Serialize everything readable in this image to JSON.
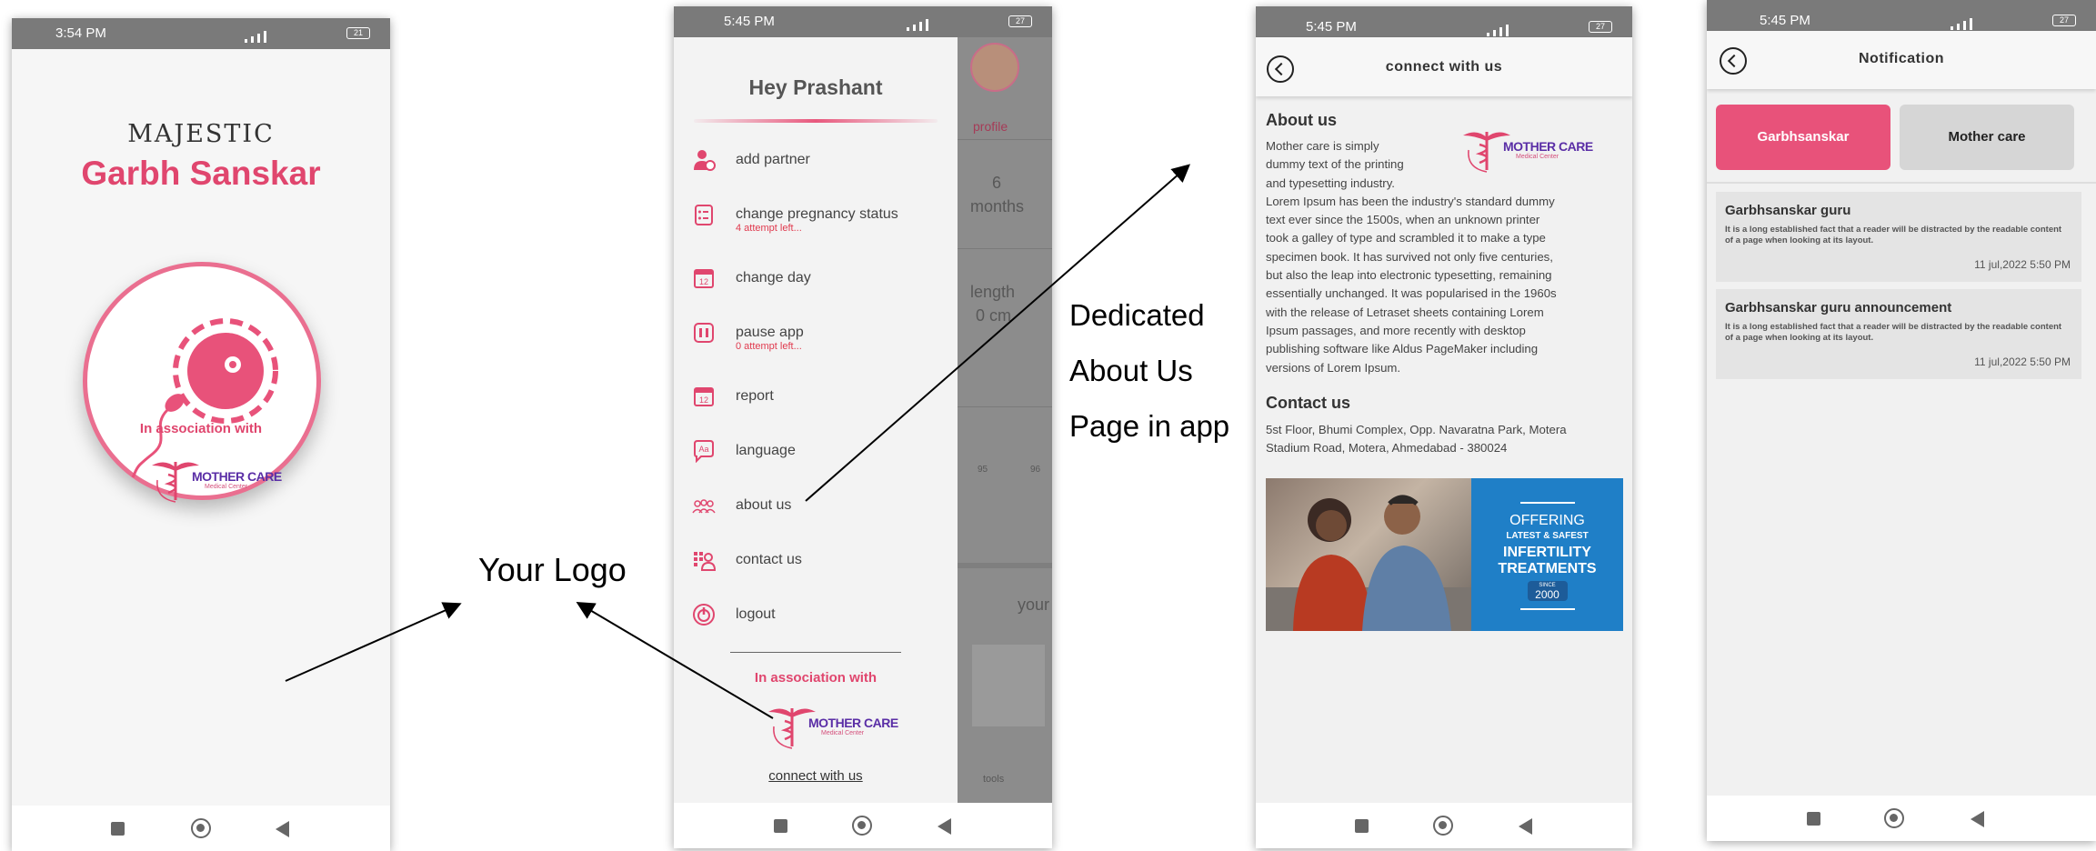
{
  "screen1": {
    "status_time": "3:54 PM",
    "battery": "21",
    "brand_line1": "MAJESTIC",
    "brand_line2": "Garbh Sanskar",
    "association_text": "In association with",
    "partner_logo_title": "MOTHER CARE",
    "partner_logo_subtitle": "Medical Center"
  },
  "screen2": {
    "status_time": "5:45 PM",
    "battery": "27",
    "greeting": "Hey Prashant",
    "menu": [
      {
        "label": "add partner",
        "icon": "person-add-icon"
      },
      {
        "label": "change pregnancy status",
        "sub": "4 attempt left...",
        "icon": "checklist-icon"
      },
      {
        "label": "change day",
        "icon": "calendar-icon"
      },
      {
        "label": "pause app",
        "sub": "0 attempt left...",
        "icon": "pause-icon"
      },
      {
        "label": "report",
        "icon": "calendar-report-icon"
      },
      {
        "label": "language",
        "icon": "language-icon"
      },
      {
        "label": "about us",
        "icon": "group-icon"
      },
      {
        "label": "contact us",
        "icon": "contact-icon"
      },
      {
        "label": "logout",
        "icon": "power-icon"
      }
    ],
    "association_text": "In association with",
    "partner_logo_title": "MOTHER CARE",
    "partner_logo_subtitle": "Medical Center",
    "connect_link": "connect with us",
    "background": {
      "profile_label": "profile",
      "months_value": "6",
      "months_label": "months",
      "length_label": "length",
      "length_value": "0 cm",
      "lock_a": "95",
      "lock_b": "96",
      "your_text": "your",
      "tools_label": "tools"
    }
  },
  "screen3": {
    "status_time": "5:45 PM",
    "battery": "27",
    "header_title": "connect with us",
    "about_heading": "About us",
    "about_lines": [
      "Mother care is simply",
      "dummy text of the printing",
      "and typesetting industry.",
      "Lorem Ipsum has been the industry's standard dummy",
      "text ever since the 1500s, when an unknown printer",
      "took a galley of type and scrambled it to make a type",
      "specimen book. It has survived not only five centuries,",
      "but also the leap into electronic typesetting, remaining",
      "essentially unchanged. It was popularised in the 1960s",
      "with the release of Letraset sheets containing Lorem",
      "Ipsum passages, and more recently with desktop",
      "publishing software like Aldus PageMaker including",
      "versions of Lorem Ipsum."
    ],
    "contact_heading": "Contact us",
    "address_lines": [
      "5st Floor, Bhumi Complex, Opp. Navaratna Park, Motera",
      "Stadium Road, Motera, Ahmedabad - 380024"
    ],
    "partner_logo_title": "MOTHER CARE",
    "partner_logo_subtitle": "Medical Center",
    "banner": {
      "line1": "OFFERING",
      "line2": "LATEST & SAFEST",
      "line3": "INFERTILITY",
      "line4": "TREATMENTS",
      "line5": "SINCE",
      "line6": "2000"
    }
  },
  "screen4": {
    "status_time": "5:45 PM",
    "battery": "27",
    "header_title": "Notification",
    "tab_active": "Garbhsanskar",
    "tab_inactive": "Mother care",
    "notifications": [
      {
        "title": "Garbhsanskar guru",
        "body": "It is a long established fact that a reader will be distracted by the readable content of a page when looking at its layout.",
        "time": "11 jul,2022 5:50 PM"
      },
      {
        "title": "Garbhsanskar guru announcement",
        "body": "It is a long established fact that a reader will be distracted by the readable content of a page when looking at its layout.",
        "time": "11 jul,2022 5:50 PM"
      }
    ]
  },
  "annotations": {
    "your_logo": "Your Logo",
    "dedicated_line1": "Dedicated",
    "dedicated_line2": "About Us",
    "dedicated_line3": "Page in app"
  },
  "colors": {
    "brand_pink": "#e0466e",
    "partner_purple": "#5a2ea6",
    "alert_red": "#e03a4e",
    "banner_blue": "#1f7fc7"
  }
}
